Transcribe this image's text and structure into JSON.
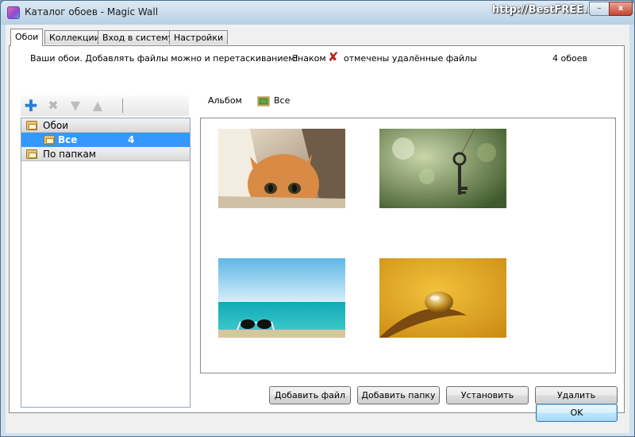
{
  "window": {
    "title": "Каталог обоев - Magic Wall",
    "watermark": "http://BestFREE.ru",
    "minimize_label": "–",
    "close_label": "x"
  },
  "tabs": [
    {
      "label": "Обои",
      "active": true
    },
    {
      "label": "Коллекции",
      "active": false
    },
    {
      "label": "Вход в систему",
      "active": false
    },
    {
      "label": "Настройки",
      "active": false
    }
  ],
  "info": {
    "hint": "Ваши обои. Добавлять файлы можно и перетаскиванием!",
    "legend_prefix": "Знаком",
    "legend_suffix": "отмечены удалённые файлы",
    "count_text": "4 обоев"
  },
  "toolbar": {
    "add_icon": "plus-icon",
    "delete_icon": "delete-x-icon",
    "down_icon": "arrow-down-icon",
    "up_icon": "arrow-up-icon"
  },
  "tree": {
    "groups": [
      {
        "label": "Обои"
      },
      {
        "label": "По папкам"
      }
    ],
    "selected_item": {
      "label": "Все",
      "count": "4"
    }
  },
  "album": {
    "label": "Альбом",
    "value": "Все"
  },
  "gallery": {
    "thumbnails": [
      {
        "name": "cat-in-box-thumbnail",
        "description": "ginger kitten peeking out of a cardboard box"
      },
      {
        "name": "hanging-key-thumbnail",
        "description": "old key hanging on a string, green bokeh"
      },
      {
        "name": "sunglasses-beach-thumbnail",
        "description": "sunglasses on sand in front of turquoise sea"
      },
      {
        "name": "water-drop-thumbnail",
        "description": "water drop on a leaf, yellow background"
      }
    ]
  },
  "buttons": {
    "add_file": "Добавить файл",
    "add_folder": "Добавить папку",
    "install": "Установить",
    "delete": "Удалить",
    "ok": "OK"
  },
  "colors": {
    "selection": "#3399ff",
    "deleted_mark": "#c21a1a"
  }
}
